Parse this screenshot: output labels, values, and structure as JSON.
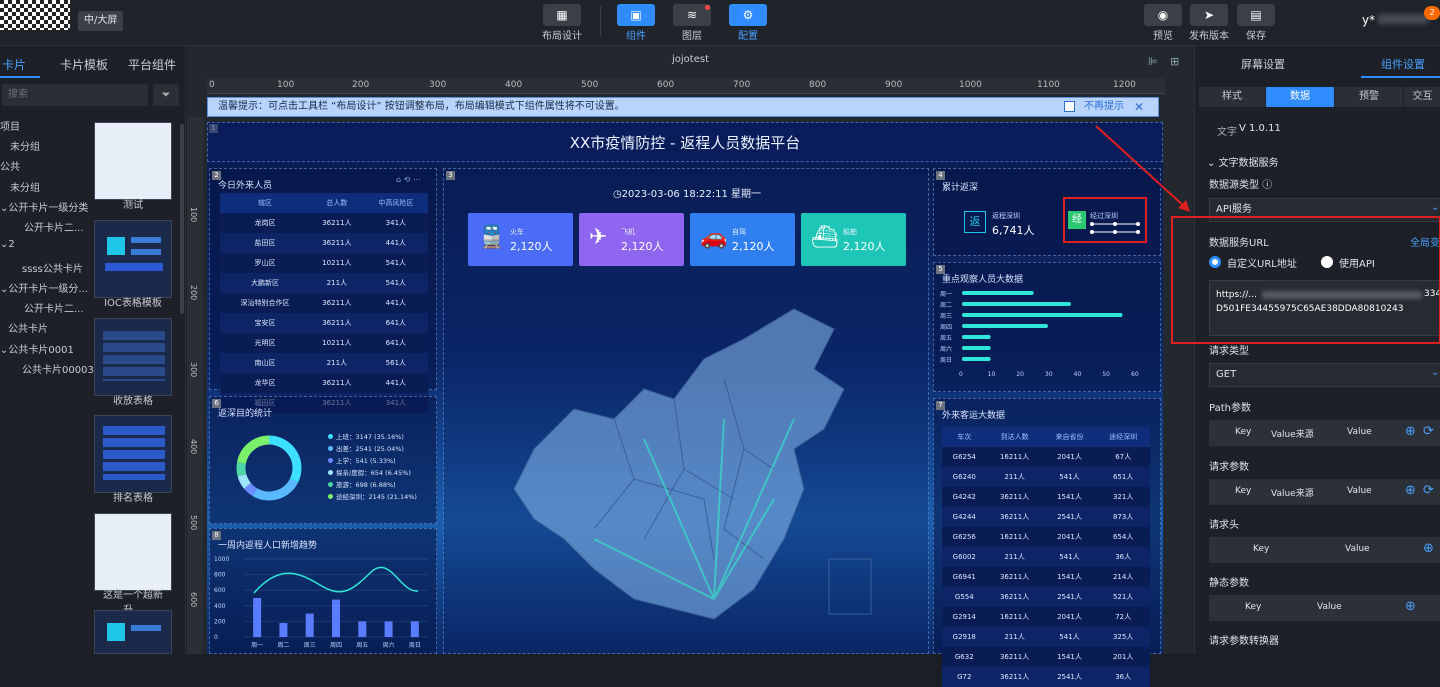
{
  "topbar": {
    "screen_tag": "中/大屏",
    "buttons": [
      {
        "label": "布局设计",
        "icon": "layout-icon"
      },
      {
        "label": "组件",
        "icon": "component-icon"
      },
      {
        "label": "图层",
        "icon": "layers-icon"
      },
      {
        "label": "配置",
        "icon": "gear-icon"
      }
    ],
    "right_buttons": [
      {
        "label": "预览",
        "icon": "eye-icon"
      },
      {
        "label": "发布版本",
        "icon": "send-icon"
      },
      {
        "label": "保存",
        "icon": "save-icon"
      }
    ],
    "user": "y*",
    "badge": "2"
  },
  "left": {
    "tabs": [
      "卡片",
      "卡片模板",
      "平台组件"
    ],
    "search_placeholder": "搜索",
    "tree": [
      "项目",
      "未分组",
      "公共",
      "未分组",
      "公开卡片一级分类",
      "公开卡片二...",
      "2",
      "ssss公共卡片",
      "公开卡片一级分...",
      "公开卡片二...",
      "公共卡片",
      "公共卡片0001",
      "公共卡片00003"
    ],
    "cards": [
      "测试",
      "IOC表格模板",
      "收放表格",
      "排名表格",
      "这是一个超新升..."
    ]
  },
  "canvas": {
    "title": "jojotest",
    "ruler": [
      "0",
      "100",
      "200",
      "300",
      "400",
      "500",
      "600",
      "700",
      "800",
      "900",
      "1000",
      "1100",
      "1200"
    ],
    "vruler": [
      "100",
      "200",
      "300",
      "400",
      "500",
      "600"
    ],
    "tip": "温馨提示：可点击工具栏 “布局设计” 按钮调整布局，布局编辑模式下组件属性将不可设置。",
    "tip_dismiss": "不再提示"
  },
  "dashboard": {
    "title": "XX市疫情防控 - 返程人员数据平台",
    "datetime": "2023-03-06  18:22:11  星期一",
    "p2_title": "今日外来人员",
    "p2_headers": [
      "辖区",
      "总人数",
      "中高风险区"
    ],
    "p2_rows": [
      [
        "龙岗区",
        "36211人",
        "341人"
      ],
      [
        "盐田区",
        "36211人",
        "441人"
      ],
      [
        "罗山区",
        "10211人",
        "541人"
      ],
      [
        "大鹏新区",
        "211人",
        "541人"
      ],
      [
        "深汕特别合作区",
        "36211人",
        "441人"
      ],
      [
        "宝安区",
        "36211人",
        "641人"
      ],
      [
        "光明区",
        "10211人",
        "641人"
      ],
      [
        "南山区",
        "211人",
        "561人"
      ],
      [
        "龙华区",
        "36211人",
        "441人"
      ],
      [
        "福田区",
        "36211人",
        "341人"
      ]
    ],
    "stat_cards": [
      {
        "label": "火车",
        "value": "2,120人",
        "color": "#4a6cf7",
        "icon": "train-icon"
      },
      {
        "label": "飞机",
        "value": "2,120人",
        "color": "#8e66f0",
        "icon": "plane-icon"
      },
      {
        "label": "自驾",
        "value": "2,120人",
        "color": "#2f7ff0",
        "icon": "car-icon"
      },
      {
        "label": "船舶",
        "value": "2,120人",
        "color": "#1ec6b8",
        "icon": "ship-icon"
      }
    ],
    "p4_title": "累计返深",
    "p4_tag1": "返",
    "p4_label1": "返程深圳",
    "p4_value1": "6,741人",
    "p4_tag2": "经",
    "p4_label2": "经过深圳",
    "p5_title": "重点观察人员大数据",
    "p5_categories": [
      "周一",
      "周二",
      "周三",
      "周四",
      "周五",
      "周六",
      "周日"
    ],
    "p5_ticks": [
      "0",
      "10",
      "20",
      "30",
      "40",
      "50",
      "60"
    ],
    "p6_title": "返深目的统计",
    "p6_legend": [
      "上班：3147 (35.16%)",
      "出差：2541 (25.04%)",
      "上学：541 (5.33%)",
      "探亲/度假：654 (6.45%)",
      "旅游：698 (6.88%)",
      "途经深圳：2145 (21.14%)"
    ],
    "p6_colors": [
      "#3ee0ff",
      "#5ab8ff",
      "#6a8cff",
      "#9ee6ff",
      "#4fd6a8",
      "#7cf06a"
    ],
    "p7_title": "外来客运大数据",
    "p7_headers": [
      "车次",
      "到达人数",
      "来自省份",
      "途经深圳"
    ],
    "p7_rows": [
      [
        "G6254",
        "16211人",
        "2041人",
        "67人"
      ],
      [
        "G6240",
        "211人",
        "541人",
        "651人"
      ],
      [
        "G4242",
        "36211人",
        "1541人",
        "321人"
      ],
      [
        "G4244",
        "36211人",
        "2541人",
        "873人"
      ],
      [
        "G6256",
        "16211人",
        "2041人",
        "654人"
      ],
      [
        "G6002",
        "211人",
        "541人",
        "36人"
      ],
      [
        "G6941",
        "36211人",
        "1541人",
        "214人"
      ],
      [
        "G554",
        "36211人",
        "2541人",
        "521人"
      ],
      [
        "G2914",
        "16211人",
        "2041人",
        "72人"
      ],
      [
        "G2918",
        "211人",
        "541人",
        "325人"
      ],
      [
        "G632",
        "36211人",
        "1541人",
        "201人"
      ],
      [
        "G72",
        "36211人",
        "2541人",
        "36人"
      ]
    ],
    "p8_title": "一周内返程人口新增趋势",
    "p8_days": [
      "周一",
      "周二",
      "周三",
      "周四",
      "周五",
      "周六",
      "周日"
    ],
    "p8_yticks": [
      "1000",
      "800",
      "600",
      "400",
      "200",
      "0"
    ]
  },
  "chart_data": [
    {
      "type": "bar",
      "title": "重点观察人员大数据",
      "categories": [
        "周一",
        "周二",
        "周三",
        "周四",
        "周五",
        "周六",
        "周日"
      ],
      "values": [
        25,
        38,
        56,
        30,
        10,
        10,
        10
      ],
      "xlim": [
        0,
        60
      ]
    },
    {
      "type": "pie",
      "title": "返深目的统计",
      "categories": [
        "上班",
        "出差",
        "上学",
        "探亲/度假",
        "旅游",
        "途经深圳"
      ],
      "values": [
        3147,
        2541,
        541,
        654,
        698,
        2145
      ]
    },
    {
      "type": "bar",
      "title": "一周内返程人口新增趋势",
      "categories": [
        "周一",
        "周二",
        "周三",
        "周四",
        "周五",
        "周六",
        "周日"
      ],
      "values": [
        500,
        180,
        300,
        480,
        200,
        200,
        200
      ],
      "ylim": [
        0,
        1000
      ]
    }
  ],
  "right": {
    "tabs": [
      "屏幕设置",
      "组件设置"
    ],
    "subtabs": [
      "样式",
      "数据",
      "预警",
      "交互"
    ],
    "text_label": "文字",
    "version": "V 1.0.11",
    "section": "文字数据服务",
    "source_type_label": "数据源类型",
    "source_type_value": "API服务",
    "url_label": "数据服务URL",
    "global_link": "全局变",
    "radio1": "自定义URL地址",
    "radio2": "使用API",
    "url_line1": "https://...",
    "url_line1_tail": "334",
    "url_line2": "D501FE34455975C65AE38DDA80810243",
    "method_label": "请求类型",
    "method_value": "GET",
    "path_label": "Path参数",
    "query_label": "请求参数",
    "header_label": "请求头",
    "static_label": "静态参数",
    "converter_label": "请求参数转换器",
    "col_key": "Key",
    "col_source": "Value来源",
    "col_value": "Value"
  }
}
